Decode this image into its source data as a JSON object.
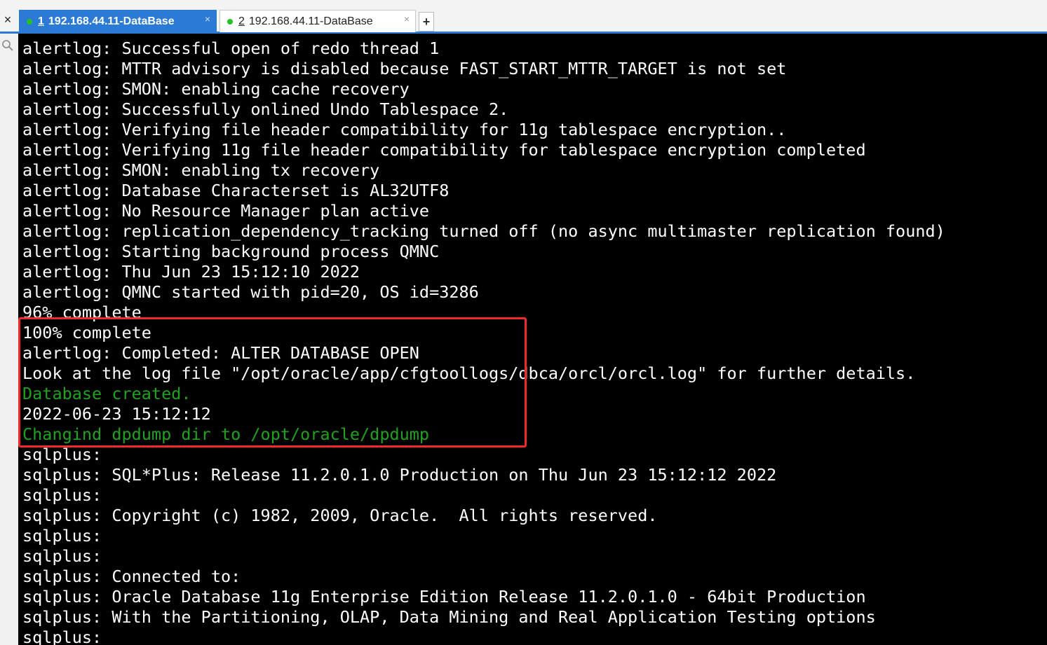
{
  "tabs": [
    {
      "number": "1",
      "title": "192.168.44.11-DataBase",
      "status_color": "#21c221",
      "active": true
    },
    {
      "number": "2",
      "title": "192.168.44.11-DataBase",
      "status_color": "#21c221",
      "active": false
    }
  ],
  "controls": {
    "left_close_glyph": "×",
    "tab_close_glyph": "×",
    "new_tab_glyph": "+"
  },
  "icons": {
    "search": "search-icon",
    "close": "close-icon",
    "plus": "plus-icon"
  },
  "colors": {
    "accent": "#2b7bd6",
    "terminal_bg": "#000000",
    "terminal_fg": "#ffffff",
    "green_text": "#1fa31f",
    "highlight_border": "#ee2a2a"
  },
  "terminal": {
    "lines": [
      {
        "text": "alertlog: Successful open of redo thread 1",
        "color": "white"
      },
      {
        "text": "alertlog: MTTR advisory is disabled because FAST_START_MTTR_TARGET is not set",
        "color": "white"
      },
      {
        "text": "alertlog: SMON: enabling cache recovery",
        "color": "white"
      },
      {
        "text": "alertlog: Successfully onlined Undo Tablespace 2.",
        "color": "white"
      },
      {
        "text": "alertlog: Verifying file header compatibility for 11g tablespace encryption..",
        "color": "white"
      },
      {
        "text": "alertlog: Verifying 11g file header compatibility for tablespace encryption completed",
        "color": "white"
      },
      {
        "text": "alertlog: SMON: enabling tx recovery",
        "color": "white"
      },
      {
        "text": "alertlog: Database Characterset is AL32UTF8",
        "color": "white"
      },
      {
        "text": "alertlog: No Resource Manager plan active",
        "color": "white"
      },
      {
        "text": "alertlog: replication_dependency_tracking turned off (no async multimaster replication found)",
        "color": "white"
      },
      {
        "text": "alertlog: Starting background process QMNC",
        "color": "white"
      },
      {
        "text": "alertlog: Thu Jun 23 15:12:10 2022",
        "color": "white"
      },
      {
        "text": "alertlog: QMNC started with pid=20, OS id=3286",
        "color": "white"
      },
      {
        "text": "96% complete",
        "color": "white"
      },
      {
        "text": "100% complete",
        "color": "white"
      },
      {
        "text": "alertlog: Completed: ALTER DATABASE OPEN",
        "color": "white"
      },
      {
        "text": "Look at the log file \"/opt/oracle/app/cfgtoollogs/dbca/orcl/orcl.log\" for further details.",
        "color": "white"
      },
      {
        "text": "Database created.",
        "color": "green"
      },
      {
        "text": "2022-06-23 15:12:12",
        "color": "white"
      },
      {
        "text": "Changind dpdump dir to /opt/oracle/dpdump",
        "color": "green"
      },
      {
        "text": "sqlplus:",
        "color": "white"
      },
      {
        "text": "sqlplus: SQL*Plus: Release 11.2.0.1.0 Production on Thu Jun 23 15:12:12 2022",
        "color": "white"
      },
      {
        "text": "sqlplus:",
        "color": "white"
      },
      {
        "text": "sqlplus: Copyright (c) 1982, 2009, Oracle.  All rights reserved.",
        "color": "white"
      },
      {
        "text": "sqlplus:",
        "color": "white"
      },
      {
        "text": "sqlplus:",
        "color": "white"
      },
      {
        "text": "sqlplus: Connected to:",
        "color": "white"
      },
      {
        "text": "sqlplus: Oracle Database 11g Enterprise Edition Release 11.2.0.1.0 - 64bit Production",
        "color": "white"
      },
      {
        "text": "sqlplus: With the Partitioning, OLAP, Data Mining and Real Application Testing options",
        "color": "white"
      },
      {
        "text": "sqlplus:",
        "color": "white"
      }
    ]
  }
}
